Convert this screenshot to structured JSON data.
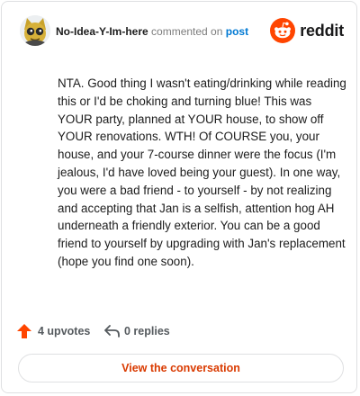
{
  "header": {
    "username": "No-Idea-Y-Im-here",
    "commented_text": "commented on",
    "post_link": "post",
    "brand": "reddit",
    "avatar_icon": "user-avatar-icon",
    "brand_icon": "reddit-alien-icon"
  },
  "comment": {
    "text": "NTA. Good thing I wasn't eating/drinking while reading this or I'd be choking and turning blue! This was YOUR party, planned at YOUR house, to show off YOUR renovations. WTH! Of COURSE you, your house, and your 7-course dinner were the focus (I'm jealous, I'd have loved being your guest). In one way, you were a bad friend - to yourself - by not realizing and accepting that Jan is a selfish, attention hog AH underneath a friendly exterior. You can be a good friend to yourself by upgrading with Jan's replacement (hope you find one soon)."
  },
  "footer": {
    "upvotes_label": "4 upvotes",
    "replies_label": "0 replies",
    "upvote_icon": "upvote-arrow-icon",
    "reply_icon": "reply-arrow-icon"
  },
  "actions": {
    "view_conversation": "View the conversation"
  },
  "colors": {
    "accent": "#d93a00",
    "brand": "#ff4500",
    "link": "#0079d3",
    "text": "#1c1c1c",
    "muted": "#555a5e",
    "border": "#dfe0e2"
  }
}
